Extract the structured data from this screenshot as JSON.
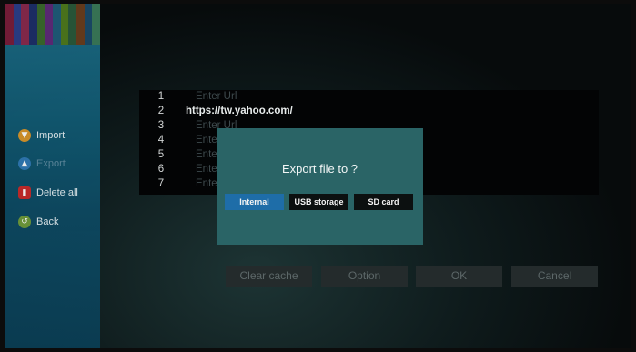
{
  "colors": {
    "sidebar": "#115a73",
    "dialog": "#2a6466",
    "selected_option": "#1e6da8",
    "import_icon": "#d9962a",
    "export_icon": "#2f79b5",
    "delete_icon": "#c82a2a",
    "back_icon": "#6f9b3a"
  },
  "icons": {
    "import": "download-circle-icon",
    "export": "upload-circle-icon",
    "delete_all": "trash-icon",
    "back": "back-arrow-icon"
  },
  "sidebar": {
    "items": [
      {
        "label": "Import"
      },
      {
        "label": "Export"
      },
      {
        "label": "Delete all"
      },
      {
        "label": "Back"
      }
    ]
  },
  "url_list": {
    "rows": [
      {
        "num": "1",
        "value": "Enter Url"
      },
      {
        "num": "2",
        "value": "https://tw.yahoo.com/"
      },
      {
        "num": "3",
        "value": "Enter Url"
      },
      {
        "num": "4",
        "value": "Enter Url"
      },
      {
        "num": "5",
        "value": "Enter Url"
      },
      {
        "num": "6",
        "value": "Enter Url"
      },
      {
        "num": "7",
        "value": "Enter Url"
      }
    ]
  },
  "buttons": {
    "clear_cache": "Clear cache",
    "option": "Option",
    "ok": "OK",
    "cancel": "Cancel"
  },
  "dialog": {
    "title": "Export file to ?",
    "options": [
      {
        "label": "Internal",
        "selected": true
      },
      {
        "label": "USB storage",
        "selected": false
      },
      {
        "label": "SD card",
        "selected": false
      }
    ]
  }
}
